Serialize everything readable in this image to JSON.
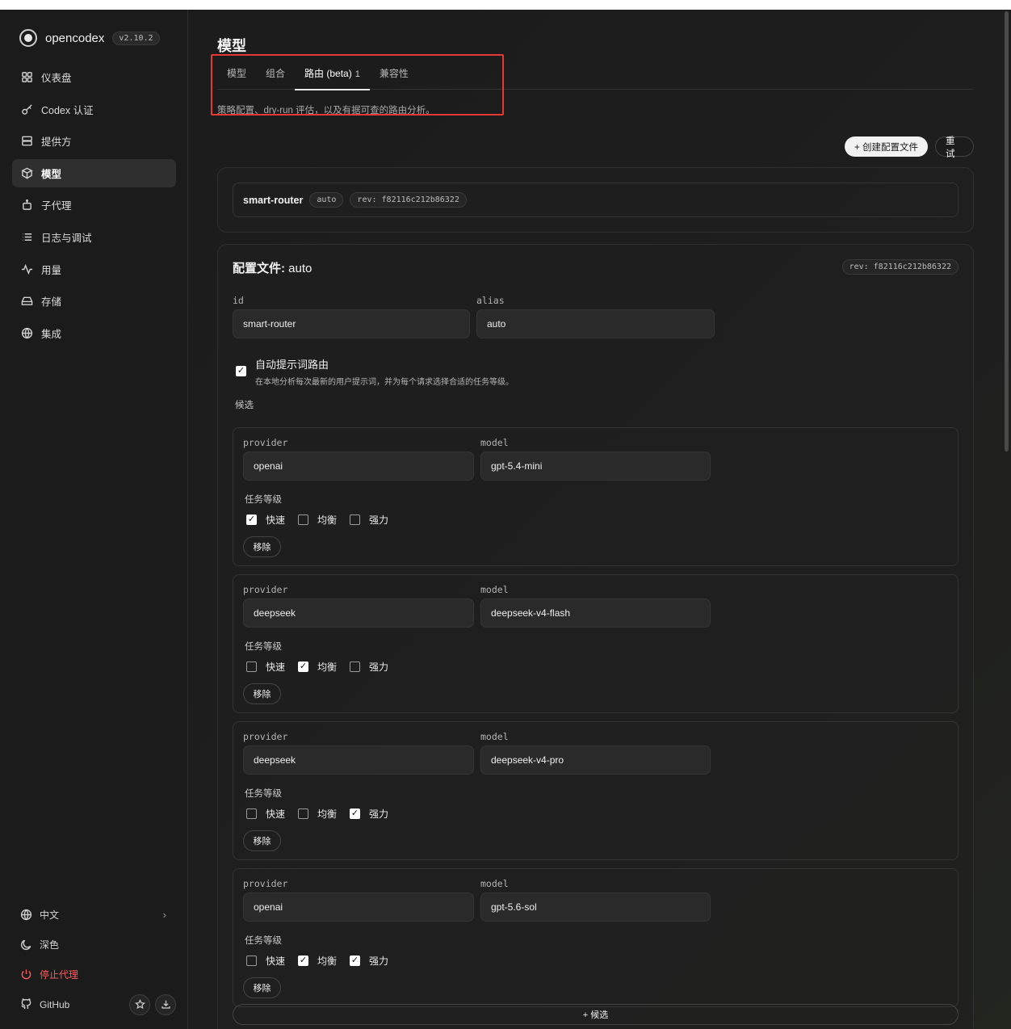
{
  "app": {
    "name": "opencodex",
    "version": "v2.10.2"
  },
  "sidebar": {
    "items": [
      {
        "label": "仪表盘",
        "icon": "grid-icon"
      },
      {
        "label": "Codex 认证",
        "icon": "key-icon"
      },
      {
        "label": "提供方",
        "icon": "server-icon"
      },
      {
        "label": "模型",
        "icon": "cube-icon",
        "active": true
      },
      {
        "label": "子代理",
        "icon": "robot-icon"
      },
      {
        "label": "日志与调试",
        "icon": "list-icon"
      },
      {
        "label": "用量",
        "icon": "activity-icon"
      },
      {
        "label": "存储",
        "icon": "drive-icon"
      },
      {
        "label": "集成",
        "icon": "globe-icon"
      }
    ],
    "bottom": {
      "language": "中文",
      "theme": "深色",
      "stop_proxy": "停止代理",
      "github": "GitHub"
    }
  },
  "page": {
    "title": "模型",
    "tabs": [
      {
        "label": "模型"
      },
      {
        "label": "组合"
      },
      {
        "label": "路由 (beta)",
        "badge": "1",
        "active": true
      },
      {
        "label": "兼容性"
      }
    ],
    "subtitle": "策略配置、dry-run 评估，以及有据可查的路由分析。",
    "create_button": "+ 创建配置文件",
    "retry_button": "重试"
  },
  "router": {
    "name": "smart-router",
    "alias_chip": "auto",
    "rev_chip": "rev: f82116c212b86322"
  },
  "config": {
    "title_prefix": "配置文件: ",
    "title_name": "auto",
    "rev_chip": "rev: f82116c212b86322",
    "id_label": "id",
    "id_value": "smart-router",
    "alias_label": "alias",
    "alias_value": "auto",
    "auto_route_title": "自动提示词路由",
    "auto_route_desc": "在本地分析每次最新的用户提示词，并为每个请求选择合适的任务等级。",
    "auto_route_checked": true,
    "candidates_label": "候选",
    "provider_label": "provider",
    "model_label": "model",
    "tier_label": "任务等级",
    "tier_names": [
      "快速",
      "均衡",
      "强力"
    ],
    "remove_label": "移除",
    "add_candidate": "+ 候选",
    "candidates": [
      {
        "provider": "openai",
        "model": "gpt-5.4-mini",
        "tiers": [
          true,
          false,
          false
        ]
      },
      {
        "provider": "deepseek",
        "model": "deepseek-v4-flash",
        "tiers": [
          false,
          true,
          false
        ]
      },
      {
        "provider": "deepseek",
        "model": "deepseek-v4-pro",
        "tiers": [
          false,
          false,
          true
        ]
      },
      {
        "provider": "openai",
        "model": "gpt-5.6-sol",
        "tiers": [
          false,
          true,
          true
        ]
      }
    ]
  }
}
